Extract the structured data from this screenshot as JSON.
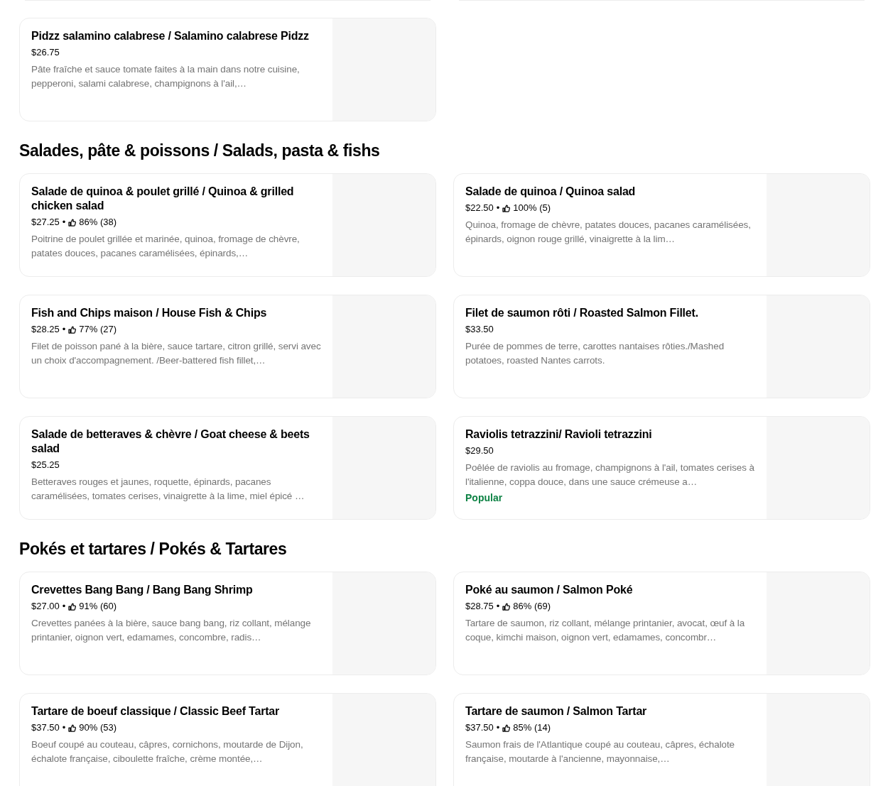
{
  "sections": [
    {
      "items": [
        {
          "name": "Pidzz salamino calabrese  / Salamino calabrese Pidzz",
          "price": "$26.75",
          "description": "Pâte fraîche et sauce tomate faites à la main dans notre cuisine, pepperoni, salami calabrese, champignons à l'ail,…"
        }
      ]
    },
    {
      "title": "Salades, pâte & poissons / Salads, pasta & fishs",
      "items": [
        {
          "name": "Salade de quinoa & poulet grillé / Quinoa & grilled chicken salad",
          "price": "$27.25",
          "rating": {
            "separator": "•",
            "percent": "86%",
            "count": "(38)"
          },
          "description": "Poitrine de poulet grillée et marinée, quinoa, fromage de chèvre, patates douces, pacanes caramélisées, épinards,…"
        },
        {
          "name": "Salade de quinoa / Quinoa salad",
          "price": "$22.50",
          "rating": {
            "separator": "•",
            "percent": "100%",
            "count": "(5)"
          },
          "description": "Quinoa, fromage de chèvre, patates douces, pacanes caramélisées, épinards, oignon rouge grillé, vinaigrette à la lim…"
        },
        {
          "name": "Fish and Chips maison  / House Fish & Chips",
          "price": "$28.25",
          "rating": {
            "separator": "•",
            "percent": "77%",
            "count": "(27)"
          },
          "description": "Filet de poisson pané à la bière, sauce tartare, citron grillé, servi avec un choix d'accompagnement. /Beer-battered fish fillet,…"
        },
        {
          "name": "Filet de saumon rôti / Roasted Salmon Fillet.",
          "price": "$33.50",
          "description": "Purée de pommes de terre, carottes nantaises rôties./Mashed potatoes, roasted Nantes carrots."
        },
        {
          "name": "Salade de betteraves & chèvre / Goat cheese & beets salad",
          "price": "$25.25",
          "description": "Betteraves rouges et jaunes, roquette, épinards, pacanes caramélisées, tomates cerises, vinaigrette à la lime, miel épicé …"
        },
        {
          "name": "Raviolis tetrazzini/ Ravioli tetrazzini",
          "price": "$29.50",
          "description": "Poêlée de raviolis au fromage, champignons à l'ail, tomates cerises à l'italienne, coppa douce, dans une sauce crémeuse a…",
          "badge": "Popular"
        }
      ]
    },
    {
      "title": "Pokés et tartares / Pokés & Tartares",
      "items": [
        {
          "name": "Crevettes Bang Bang / Bang Bang Shrimp",
          "price": "$27.00",
          "rating": {
            "separator": "•",
            "percent": "91%",
            "count": "(60)"
          },
          "description": "Crevettes panées à la bière, sauce bang bang, riz collant, mélange printanier, oignon vert, edamames, concombre, radis…"
        },
        {
          "name": "Poké au saumon / Salmon Poké",
          "price": "$28.75",
          "rating": {
            "separator": "•",
            "percent": "86%",
            "count": "(69)"
          },
          "description": "Tartare de saumon, riz collant, mélange printanier, avocat, œuf à la coque, kimchi maison, oignon vert, edamames, concombr…"
        },
        {
          "name": "Tartare de boeuf classique / Classic Beef Tartar",
          "price": "$37.50",
          "rating": {
            "separator": "•",
            "percent": "90%",
            "count": "(53)"
          },
          "description": "Boeuf coupé au couteau, câpres, cornichons, moutarde de Dijon, échalote française, ciboulette fraîche, crème montée,…"
        },
        {
          "name": "Tartare de saumon / Salmon Tartar",
          "price": "$37.50",
          "rating": {
            "separator": "•",
            "percent": "85%",
            "count": "(14)"
          },
          "description": "Saumon frais de l'Atlantique coupé au couteau, câpres, échalote française, moutarde à l'ancienne, mayonnaise,…"
        }
      ]
    }
  ]
}
